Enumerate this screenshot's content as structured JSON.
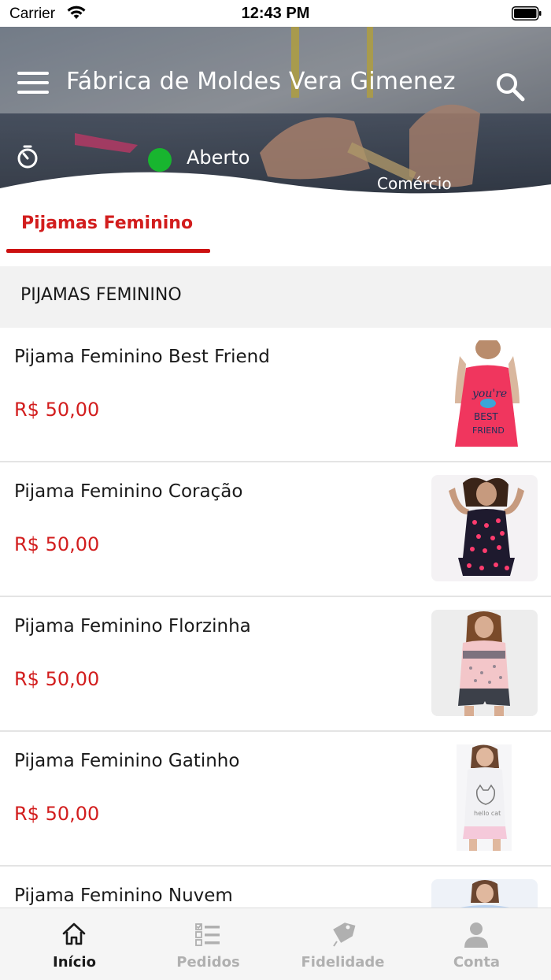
{
  "status_bar": {
    "carrier": "Carrier",
    "time": "12:43 PM"
  },
  "header": {
    "store_name": "Fábrica de Moldes Vera Gimenez",
    "status": "Aberto",
    "status_color": "#18b52f",
    "category": "Comércio",
    "icons": [
      "menu-icon",
      "search-icon",
      "timer-icon"
    ]
  },
  "tabs": [
    {
      "label": "Pijamas Feminino",
      "active": true
    }
  ],
  "section": {
    "title": "PIJAMAS FEMININO"
  },
  "products": [
    {
      "name": "Pijama Feminino Best Friend",
      "price": "R$ 50,00"
    },
    {
      "name": "Pijama Feminino Coração",
      "price": "R$ 50,00"
    },
    {
      "name": "Pijama Feminino Florzinha",
      "price": "R$ 50,00"
    },
    {
      "name": "Pijama Feminino Gatinho",
      "price": "R$ 50,00"
    },
    {
      "name": "Pijama Feminino Nuvem",
      "price": ""
    }
  ],
  "bottom_nav": [
    {
      "label": "Início",
      "icon": "home-icon",
      "active": true
    },
    {
      "label": "Pedidos",
      "icon": "orders-list-icon",
      "active": false
    },
    {
      "label": "Fidelidade",
      "icon": "loyalty-tag-icon",
      "active": false
    },
    {
      "label": "Conta",
      "icon": "account-icon",
      "active": false
    }
  ],
  "colors": {
    "accent": "#d21d1d",
    "status_open": "#18b52f",
    "section_bg": "#f2f2f2",
    "nav_inactive": "#b0b0b0"
  }
}
